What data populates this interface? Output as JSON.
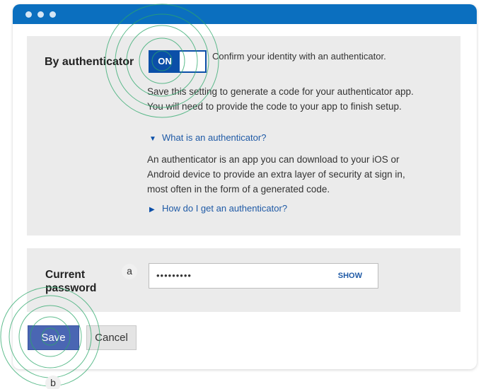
{
  "authenticator": {
    "label": "By authenticator",
    "toggle_state": "ON",
    "description": "Confirm your identity with an authenticator.",
    "save_note": "Save this setting to generate a code for your authenticator app. You will need to provide the code to your app to finish setup.",
    "what_is": {
      "label": "What is an authenticator?",
      "expanded": true,
      "content": "An authenticator is an app you can download to your iOS or Android device to provide an extra layer of security at sign in, most often in the form of a generated code."
    },
    "how_to_get": {
      "label": "How do I get an authenticator?",
      "expanded": false
    }
  },
  "password": {
    "label": "Current password",
    "value": "•••••••••",
    "show_label": "SHOW"
  },
  "actions": {
    "save_label": "Save",
    "cancel_label": "Cancel"
  },
  "markers": {
    "a": "a",
    "b": "b"
  },
  "colors": {
    "titlebar": "#0b6fbf",
    "toggle": "#0b4fa8",
    "save_button": "#4a66b3",
    "link": "#1f5aa6",
    "ripple": "#2ca86a",
    "panel": "#ebebeb"
  },
  "icons": {
    "expanded": "triangle-down-icon",
    "collapsed": "triangle-right-icon"
  }
}
